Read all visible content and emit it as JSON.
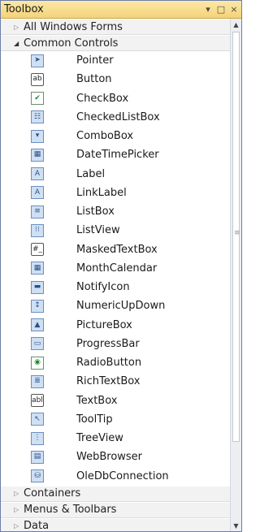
{
  "panel": {
    "title": "Toolbox",
    "pin_glyph": "▾",
    "max_glyph": "□",
    "close_glyph": "×"
  },
  "groups": {
    "all_windows_forms": "All Windows Forms",
    "common_controls": "Common Controls",
    "containers": "Containers",
    "menus_toolbars": "Menus & Toolbars",
    "data": "Data"
  },
  "items": [
    {
      "label": "Pointer",
      "icon": "pointer-icon",
      "glyph": "➤"
    },
    {
      "label": "Button",
      "icon": "button-icon",
      "glyph": "ab"
    },
    {
      "label": "CheckBox",
      "icon": "checkbox-icon",
      "glyph": "✔"
    },
    {
      "label": "CheckedListBox",
      "icon": "checkedlistbox-icon",
      "glyph": "☷"
    },
    {
      "label": "ComboBox",
      "icon": "combobox-icon",
      "glyph": "▾"
    },
    {
      "label": "DateTimePicker",
      "icon": "datetimepicker-icon",
      "glyph": "▦"
    },
    {
      "label": "Label",
      "icon": "label-icon",
      "glyph": "A"
    },
    {
      "label": "LinkLabel",
      "icon": "linklabel-icon",
      "glyph": "A"
    },
    {
      "label": "ListBox",
      "icon": "listbox-icon",
      "glyph": "≡"
    },
    {
      "label": "ListView",
      "icon": "listview-icon",
      "glyph": "⁝⁝"
    },
    {
      "label": "MaskedTextBox",
      "icon": "maskedtextbox-icon",
      "glyph": "#_"
    },
    {
      "label": "MonthCalendar",
      "icon": "monthcalendar-icon",
      "glyph": "▦"
    },
    {
      "label": "NotifyIcon",
      "icon": "notifyicon-icon",
      "glyph": "▬"
    },
    {
      "label": "NumericUpDown",
      "icon": "numericupdown-icon",
      "glyph": "↕"
    },
    {
      "label": "PictureBox",
      "icon": "picturebox-icon",
      "glyph": "▲"
    },
    {
      "label": "ProgressBar",
      "icon": "progressbar-icon",
      "glyph": "▭"
    },
    {
      "label": "RadioButton",
      "icon": "radiobutton-icon",
      "glyph": "◉"
    },
    {
      "label": "RichTextBox",
      "icon": "richtextbox-icon",
      "glyph": "≣"
    },
    {
      "label": "TextBox",
      "icon": "textbox-icon",
      "glyph": "abl"
    },
    {
      "label": "ToolTip",
      "icon": "tooltip-icon",
      "glyph": "↖"
    },
    {
      "label": "TreeView",
      "icon": "treeview-icon",
      "glyph": "⋮"
    },
    {
      "label": "WebBrowser",
      "icon": "webbrowser-icon",
      "glyph": "▤"
    },
    {
      "label": "OleDbConnection",
      "icon": "oledbconnection-icon",
      "glyph": "⛁"
    }
  ]
}
